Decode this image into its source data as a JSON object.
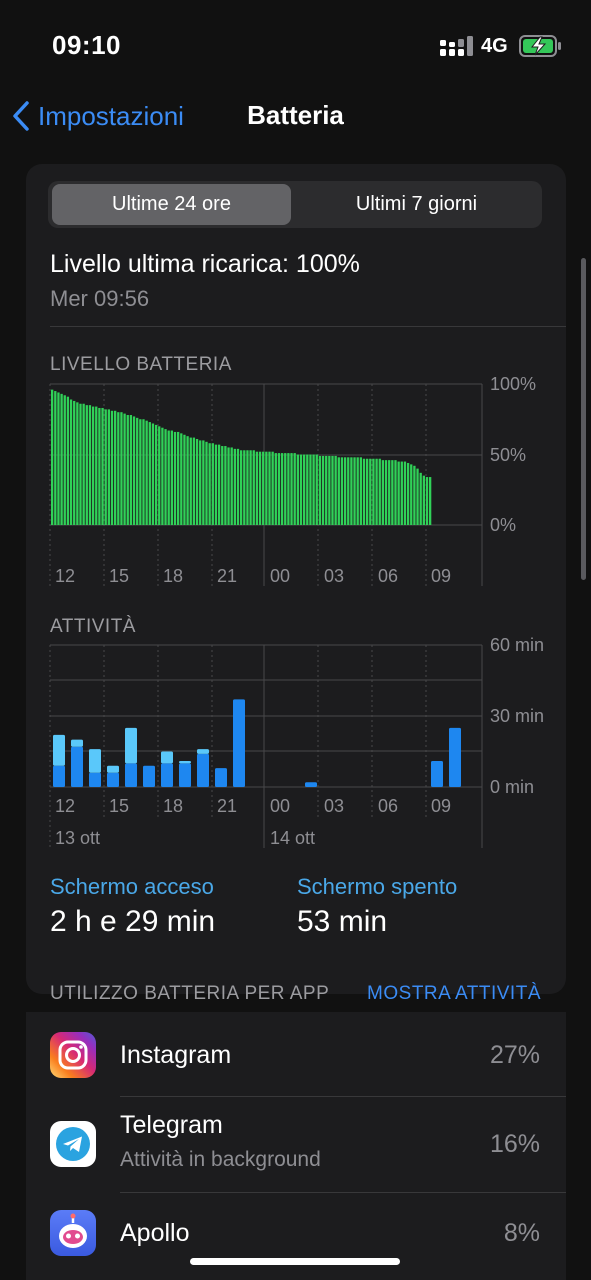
{
  "status_bar": {
    "time": "09:10",
    "network": "4G"
  },
  "nav": {
    "back_label": "Impostazioni",
    "title": "Batteria"
  },
  "segmented": {
    "options": [
      "Ultime 24 ore",
      "Ultimi 7 giorni"
    ],
    "selected": "Ultime 24 ore"
  },
  "last_charge": {
    "label": "Livello ultima ricarica: 100%",
    "date": "Mer 09:56"
  },
  "battery_chart": {
    "label": "LIVELLO BATTERIA",
    "y_ticks": [
      "100%",
      "50%",
      "0%"
    ],
    "x_ticks": [
      "12",
      "15",
      "18",
      "21",
      "00",
      "03",
      "06",
      "09"
    ]
  },
  "activity_chart": {
    "label": "ATTIVITÀ",
    "y_ticks": [
      "60 min",
      "30 min",
      "0 min"
    ],
    "x_ticks": [
      "12",
      "15",
      "18",
      "21",
      "00",
      "03",
      "06",
      "09"
    ],
    "date_labels": [
      "13 ott",
      "14 ott"
    ]
  },
  "chart_data": [
    {
      "type": "bar",
      "title": "LIVELLO BATTERIA",
      "ylim": [
        0,
        100
      ],
      "y_unit": "%",
      "x_range": [
        "11:00",
        "09:00"
      ],
      "bar_interval_minutes": 15,
      "color": "#30d158",
      "values": [
        96,
        95,
        94,
        93,
        92,
        91,
        89,
        88,
        87,
        86,
        86,
        85,
        85,
        84,
        84,
        83,
        83,
        82,
        82,
        81,
        81,
        80,
        80,
        79,
        78,
        78,
        77,
        76,
        75,
        75,
        74,
        73,
        72,
        71,
        70,
        69,
        68,
        67,
        67,
        66,
        66,
        65,
        64,
        63,
        62,
        62,
        61,
        60,
        60,
        59,
        58,
        58,
        57,
        57,
        56,
        56,
        55,
        55,
        54,
        54,
        53,
        53,
        53,
        53,
        53,
        52,
        52,
        52,
        52,
        52,
        52,
        51,
        51,
        51,
        51,
        51,
        51,
        51,
        50,
        50,
        50,
        50,
        50,
        50,
        50,
        49,
        49,
        49,
        49,
        49,
        49,
        48,
        48,
        48,
        48,
        48,
        48,
        48,
        48,
        47,
        47,
        47,
        47,
        47,
        47,
        46,
        46,
        46,
        46,
        46,
        45,
        45,
        45,
        44,
        43,
        42,
        40,
        37,
        35,
        34,
        34
      ]
    },
    {
      "type": "bar",
      "title": "ATTIVITÀ",
      "ylim": [
        0,
        60
      ],
      "y_unit": "min",
      "hours": [
        "11",
        "12",
        "13",
        "14",
        "15",
        "16",
        "17",
        "18",
        "19",
        "20",
        "21",
        "22",
        "23",
        "00",
        "01",
        "02",
        "03",
        "04",
        "05",
        "06",
        "07",
        "08",
        "09"
      ],
      "series": [
        {
          "name": "Schermo acceso",
          "color": "#1e87f0",
          "values": [
            9,
            17,
            6,
            6,
            10,
            9,
            10,
            10,
            14,
            8,
            37,
            0,
            0,
            0,
            2,
            0,
            0,
            0,
            0,
            0,
            0,
            11,
            25
          ]
        },
        {
          "name": "Schermo spento",
          "color": "#5ac8fa",
          "values": [
            13,
            3,
            10,
            3,
            15,
            0,
            5,
            1,
            2,
            0,
            0,
            0,
            0,
            0,
            0,
            0,
            0,
            0,
            0,
            0,
            0,
            0,
            0
          ]
        }
      ]
    }
  ],
  "stats": {
    "screen_on": {
      "label": "Schermo acceso",
      "value": "2 h e 29 min"
    },
    "screen_off": {
      "label": "Schermo spento",
      "value": "53 min"
    }
  },
  "usage": {
    "header": "UTILIZZO BATTERIA PER APP",
    "show_activity": "MOSTRA ATTIVITÀ",
    "apps": [
      {
        "name": "Instagram",
        "subtitle": "",
        "percent": "27%"
      },
      {
        "name": "Telegram",
        "subtitle": "Attività in background",
        "percent": "16%"
      },
      {
        "name": "Apollo",
        "subtitle": "",
        "percent": "8%"
      }
    ]
  }
}
